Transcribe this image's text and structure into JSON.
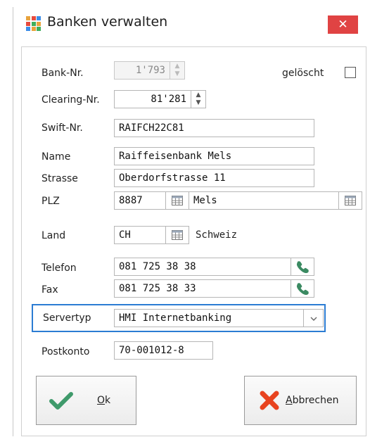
{
  "window": {
    "title": "Banken verwalten",
    "close_symbol": "✕"
  },
  "form": {
    "bank_nr": {
      "label": "Bank-Nr.",
      "value": "1'793"
    },
    "geloescht": {
      "label": "gelöscht",
      "checked": false
    },
    "clearing_nr": {
      "label": "Clearing-Nr.",
      "value": "81'281"
    },
    "swift_nr": {
      "label": "Swift-Nr.",
      "value": "RAIFCH22C81"
    },
    "name": {
      "label": "Name",
      "value": "Raiffeisenbank Mels"
    },
    "strasse": {
      "label": "Strasse",
      "value": "Oberdorfstrasse 11"
    },
    "plz": {
      "label": "PLZ",
      "value": "8887",
      "ort": "Mels"
    },
    "land": {
      "label": "Land",
      "value": "CH",
      "country_name": "Schweiz"
    },
    "telefon": {
      "label": "Telefon",
      "value": "081 725 38 38"
    },
    "fax": {
      "label": "Fax",
      "value": "081 725 38 33"
    },
    "servertyp": {
      "label": "Servertyp",
      "value": "HMI Internetbanking"
    },
    "postkonto": {
      "label": "Postkonto",
      "value": "70-001012-8"
    }
  },
  "buttons": {
    "ok": {
      "label_u": "O",
      "label_rest": "k"
    },
    "cancel": {
      "label_u": "A",
      "label_rest": "bbrechen"
    }
  },
  "colors": {
    "accent": "#2b7cd3",
    "close": "#e04343",
    "ok_check": "#3f9a6b",
    "cancel_x": "#e8431f",
    "phone": "#3b8a62"
  },
  "icons": [
    "app-grid-icon",
    "close-icon",
    "spinner-icon",
    "calendar-icon",
    "phone-icon",
    "chevron-down-icon",
    "checkmark-icon",
    "cross-icon"
  ]
}
